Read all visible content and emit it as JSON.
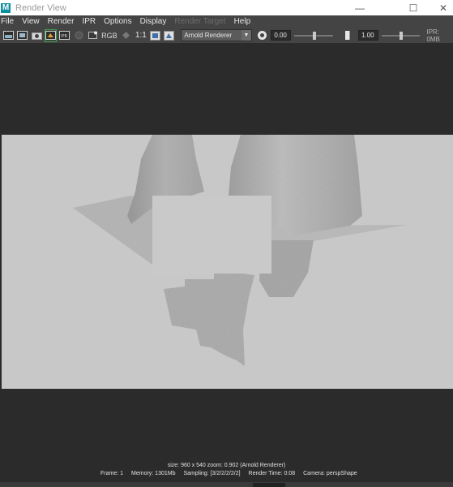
{
  "window": {
    "logo": "M",
    "title": "Render View",
    "controls": {
      "minimize": "—",
      "maximize": "☐",
      "close": "✕"
    }
  },
  "menu": [
    "File",
    "View",
    "Render",
    "IPR",
    "Options",
    "Display",
    "Render Target",
    "Help"
  ],
  "toolbar": {
    "rgb_label": "RGB",
    "ratio_label": "1:1",
    "renderer": "Arnold Renderer",
    "exposure_value": "0.00",
    "gamma_value": "1.00",
    "ipr_memory": "IPR: 0MB",
    "icons": [
      "render-frame-icon",
      "render-region-icon",
      "snapshot-icon",
      "ipr-render-icon",
      "refresh-ipr-icon",
      "stop-icon",
      "keep-image-icon",
      "remove-image-icon",
      "display-rgb-icon",
      "display-alpha-icon",
      "real-size-icon",
      "frame-image-icon",
      "frame-region-icon",
      "exposure-icon",
      "gamma-icon"
    ]
  },
  "colors": {
    "ui_dark": "#2b2b2b",
    "ui_bar": "#444444",
    "render_bg": "#c8c8c8",
    "accent": "#0e8f9e",
    "ipr_highlight": "#3c9c4a"
  },
  "status": {
    "line1": "size: 960 x 540 zoom: 0.902     (Arnold Renderer)",
    "frame": "Frame: 1",
    "memory": "Memory: 1301Mb",
    "sampling": "Sampling: [3/2/2/2/2/2]",
    "render_time": "Render Time: 0:08",
    "camera": "Camera: perspShape"
  }
}
